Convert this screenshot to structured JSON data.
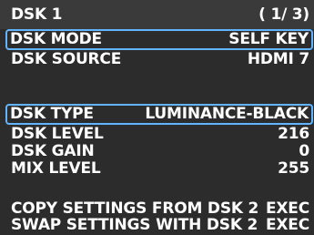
{
  "header": {
    "title": "DSK 1",
    "page": "( 1/ 3)"
  },
  "rows": {
    "dsk_mode": {
      "label": "DSK MODE",
      "value": "SELF KEY"
    },
    "dsk_source": {
      "label": "DSK SOURCE",
      "value": "HDMI 7"
    },
    "dsk_type": {
      "label": "DSK TYPE",
      "value": "LUMINANCE-BLACK"
    },
    "dsk_level": {
      "label": "DSK LEVEL",
      "value": "216"
    },
    "dsk_gain": {
      "label": "DSK GAIN",
      "value": "0"
    },
    "mix_level": {
      "label": "MIX LEVEL",
      "value": "255"
    },
    "copy": {
      "label": "COPY SETTINGS FROM DSK 2",
      "value": "EXEC"
    },
    "swap": {
      "label": "SWAP SETTINGS WITH DSK 2",
      "value": "EXEC"
    }
  },
  "colors": {
    "background": "#2c2c2c",
    "header_bg": "#3a3a3a",
    "highlight": "#63b4ff",
    "text": "#ffffff"
  }
}
